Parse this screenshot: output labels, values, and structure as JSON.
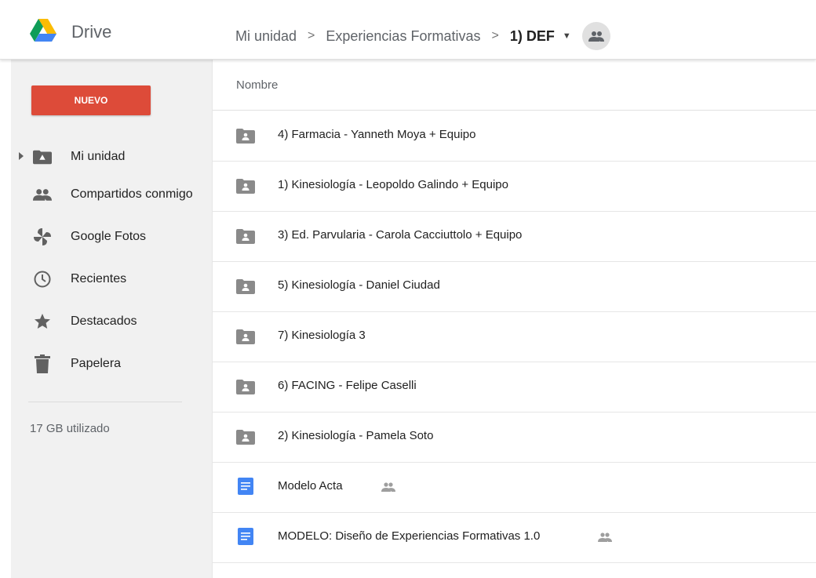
{
  "header": {
    "app_title": "Drive",
    "breadcrumb": [
      "Mi unidad",
      "Experiencias Formativas",
      "1) DEF"
    ],
    "separator": ">"
  },
  "sidebar": {
    "new_button_label": "NUEVO",
    "items": [
      {
        "label": "Mi unidad",
        "icon": "my-drive-icon"
      },
      {
        "label": "Compartidos conmigo",
        "icon": "people-icon"
      },
      {
        "label": "Google Fotos",
        "icon": "photos-pinwheel-icon"
      },
      {
        "label": "Recientes",
        "icon": "clock-icon"
      },
      {
        "label": "Destacados",
        "icon": "star-icon"
      },
      {
        "label": "Papelera",
        "icon": "trash-icon"
      }
    ],
    "storage_text": "17 GB utilizado"
  },
  "list": {
    "column_name": "Nombre",
    "rows": [
      {
        "name": "4) Farmacia - Yanneth Moya + Equipo",
        "type": "shared-folder"
      },
      {
        "name": "1) Kinesiología - Leopoldo Galindo + Equipo",
        "type": "shared-folder"
      },
      {
        "name": "3) Ed. Parvularia - Carola Cacciuttolo + Equipo",
        "type": "shared-folder"
      },
      {
        "name": "5) Kinesiología - Daniel Ciudad",
        "type": "shared-folder"
      },
      {
        "name": "7) Kinesiología 3",
        "type": "shared-folder"
      },
      {
        "name": "6) FACING - Felipe Caselli",
        "type": "shared-folder"
      },
      {
        "name": "2) Kinesiología - Pamela Soto",
        "type": "shared-folder"
      },
      {
        "name": "Modelo Acta",
        "type": "google-doc",
        "shared": true
      },
      {
        "name": "MODELO: Diseño de Experiencias Formativas 1.0",
        "type": "google-doc",
        "shared": true
      }
    ]
  },
  "colors": {
    "new_button": "#dd4b39",
    "folder_icon": "#8a8a8a",
    "doc_icon": "#4285f4",
    "sidebar_bg": "#f1f1f1"
  }
}
